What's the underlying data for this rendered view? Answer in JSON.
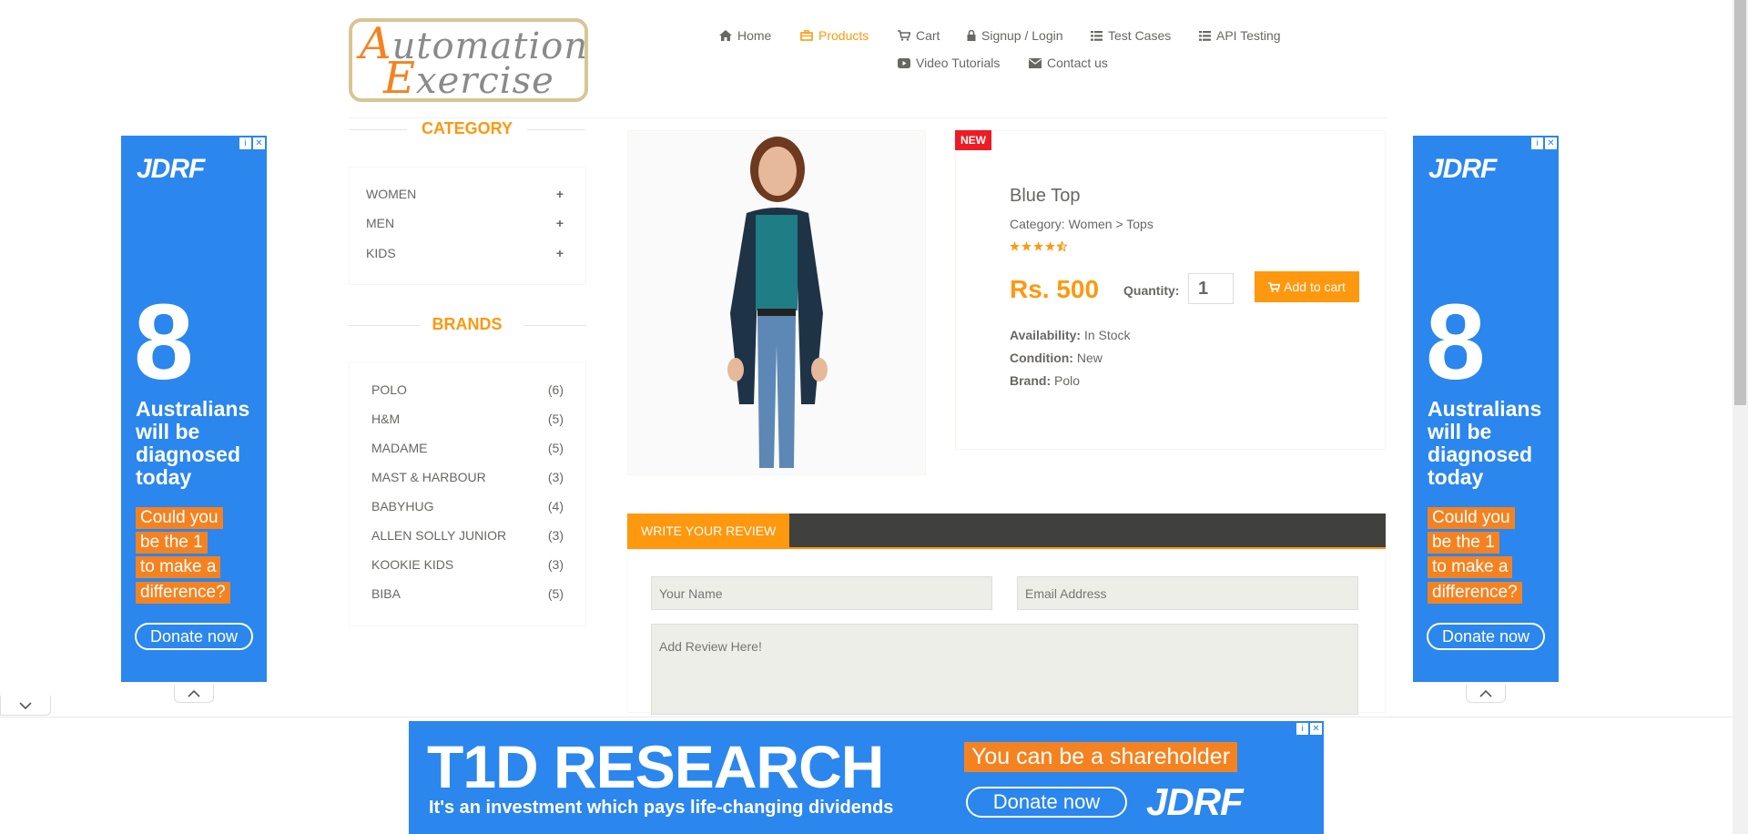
{
  "logo": {
    "word1_cap": "A",
    "word1_rest": "utomation",
    "word2_cap": "E",
    "word2_rest": "xercise"
  },
  "nav": [
    {
      "label": "Home",
      "icon": "home-icon"
    },
    {
      "label": "Products",
      "icon": "products-icon",
      "active": true
    },
    {
      "label": "Cart",
      "icon": "cart-icon"
    },
    {
      "label": "Signup / Login",
      "icon": "lock-icon"
    },
    {
      "label": "Test Cases",
      "icon": "list-icon"
    },
    {
      "label": "API Testing",
      "icon": "list-icon"
    },
    {
      "label": "Video Tutorials",
      "icon": "youtube-icon"
    },
    {
      "label": "Contact us",
      "icon": "envelope-icon"
    }
  ],
  "sidebar": {
    "category_title": "CATEGORY",
    "categories": [
      {
        "label": "WOMEN",
        "toggle": "+"
      },
      {
        "label": "MEN",
        "toggle": "+"
      },
      {
        "label": "KIDS",
        "toggle": "+"
      }
    ],
    "brands_title": "BRANDS",
    "brands": [
      {
        "label": "POLO",
        "count": "(6)"
      },
      {
        "label": "H&M",
        "count": "(5)"
      },
      {
        "label": "MADAME",
        "count": "(5)"
      },
      {
        "label": "MAST & HARBOUR",
        "count": "(3)"
      },
      {
        "label": "BABYHUG",
        "count": "(4)"
      },
      {
        "label": "ALLEN SOLLY JUNIOR",
        "count": "(3)"
      },
      {
        "label": "KOOKIE KIDS",
        "count": "(3)"
      },
      {
        "label": "BIBA",
        "count": "(5)"
      }
    ]
  },
  "product": {
    "badge": "NEW",
    "name": "Blue Top",
    "category": "Category: Women > Tops",
    "rating": 4.5,
    "price": "Rs. 500",
    "quantity_label": "Quantity:",
    "quantity": "1",
    "add_to_cart": "Add to cart",
    "availability_label": "Availability:",
    "availability": "In Stock",
    "condition_label": "Condition:",
    "condition": "New",
    "brand_label": "Brand:",
    "brand": "Polo"
  },
  "review": {
    "tab": "WRITE YOUR REVIEW",
    "name_placeholder": "Your Name",
    "email_placeholder": "Email Address",
    "review_placeholder": "Add Review Here!"
  },
  "side_ad": {
    "logo": "JDRF",
    "number": "8",
    "text_lines": [
      "Australians",
      "will be",
      "diagnosed",
      "today"
    ],
    "highlight_lines": [
      "Could you",
      "be the 1",
      "to make a",
      "difference?"
    ],
    "donate": "Donate now"
  },
  "bottom_ad": {
    "headline": "T1D RESEARCH",
    "subline": "It's an investment which pays life-changing dividends",
    "highlight": "You can be a shareholder",
    "donate": "Donate now",
    "logo": "JDRF"
  },
  "colors": {
    "accent": "#fe980f",
    "ad_blue": "#2b86ee",
    "ad_orange": "#f58220",
    "badge_red": "#ed1c24"
  }
}
